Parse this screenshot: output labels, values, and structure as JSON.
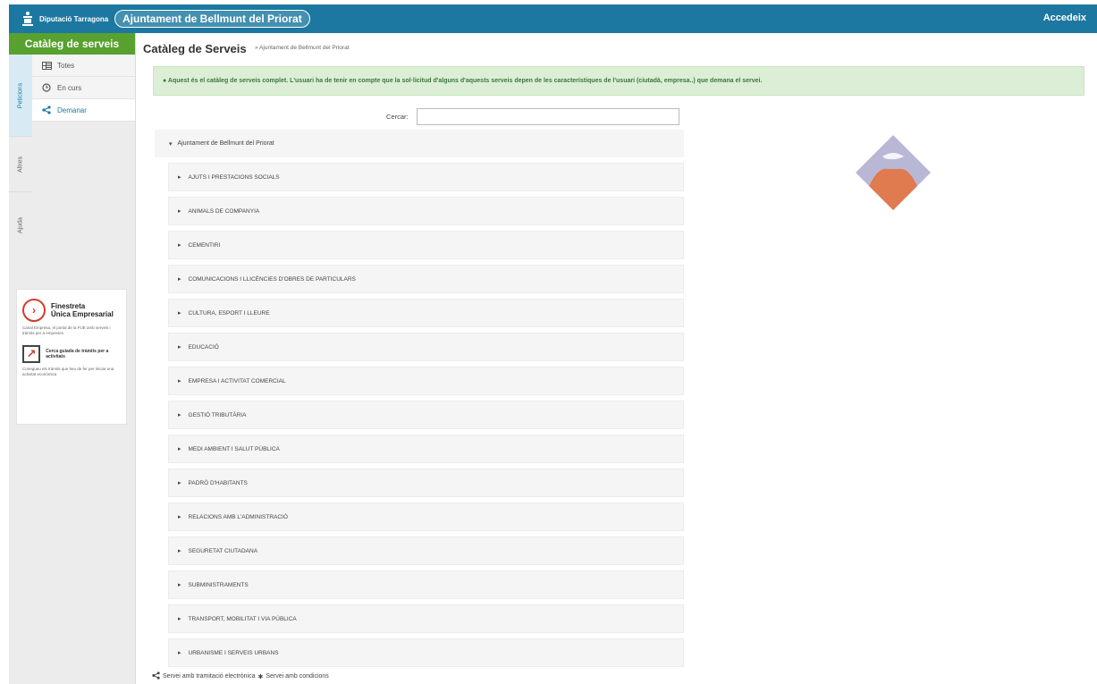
{
  "header": {
    "brand_text": "Diputació Tarragona",
    "council_name": "Ajuntament de Bellmunt del Priorat",
    "login_label": "Accedeix"
  },
  "sidebar": {
    "title": "Catàleg de serveis",
    "vertical_tabs": [
      {
        "label": "Peticions",
        "icon": "tab-peticions",
        "active": true
      },
      {
        "label": "Altres",
        "icon": "tab-altres",
        "active": false
      },
      {
        "label": "Ajuda",
        "icon": "tab-ajuda",
        "active": false
      }
    ],
    "items": [
      {
        "label": "Totes",
        "icon": "list-icon",
        "active": false
      },
      {
        "label": "En curs",
        "icon": "clock-icon",
        "active": false
      },
      {
        "label": "Demanar",
        "icon": "share-icon",
        "active": true
      }
    ],
    "promo": {
      "title_line1": "Finestreta",
      "title_line2": "Única Empresarial",
      "text1": "Canal Empresa, el portal de la FUE amb serveis i tràmits per a empreses",
      "subtitle": "Cerca guiada de tràmits per a activitats",
      "text2": "Conegueu els tràmits que heu de fer per iniciar una activitat econòmica"
    }
  },
  "main": {
    "title": "Catàleg de Serveis",
    "breadcrumb": "» Ajuntament de Bellmunt del Priorat",
    "info": "Aquest és el catàleg de serveis complet. L'usuari ha de tenir en compte que la sol·licitud d'alguns d'aquests serveis depen de les característiques de l'usuari (ciutadà, empresa..) que demana el servei.",
    "search_label": "Cercar:",
    "search_value": "",
    "tree_root": "Ajuntament de Bellmunt del Priorat",
    "categories": [
      "AJUTS I PRESTACIONS SOCIALS",
      "ANIMALS DE COMPANYIA",
      "CEMENTIRI",
      "COMUNICACIONS I LLICÈNCIES D'OBRES DE PARTICULARS",
      "CULTURA, ESPORT I LLEURE",
      "EDUCACIÓ",
      "EMPRESA I ACTIVITAT COMERCIAL",
      "GESTIÓ TRIBUTÀRIA",
      "MEDI AMBIENT I SALUT PÚBLICA",
      "PADRÓ D'HABITANTS",
      "RELACIONS AMB L'ADMINISTRACIÓ",
      "SEGURETAT CIUTADANA",
      "SUBMINISTRAMENTS",
      "TRANSPORT, MOBILITAT I VIA PÚBLICA",
      "URBANISME I SERVEIS URBANS"
    ],
    "legend": {
      "electronic": "Servei amb tramitació electrònica",
      "conditions": "Servei amb condicions"
    }
  },
  "colors": {
    "topbar": "#1c78a0",
    "sidebar_head": "#58a12f",
    "info_bg": "#dcefd6",
    "info_text": "#3c763d",
    "emblem_top": "#b9b7d6",
    "emblem_bottom": "#e07a4f"
  }
}
